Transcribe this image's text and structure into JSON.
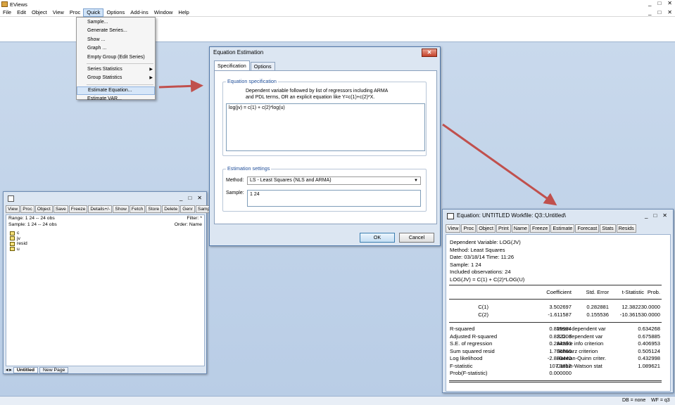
{
  "app": {
    "title": "EViews",
    "window_controls": [
      "_",
      "□",
      "✕"
    ],
    "doc_controls": [
      "_",
      "□",
      "✕"
    ]
  },
  "menubar": {
    "items": [
      "File",
      "Edit",
      "Object",
      "View",
      "Proc",
      "Quick",
      "Options",
      "Add-ins",
      "Window",
      "Help"
    ],
    "active": "Quick"
  },
  "quick_menu": {
    "items": [
      {
        "label": "Sample..."
      },
      {
        "label": "Generate Series..."
      },
      {
        "label": "Show ..."
      },
      {
        "label": "Graph ..."
      },
      {
        "label": "Empty Group (Edit Series)"
      },
      {
        "label": "Series Statistics",
        "submenu": "▶"
      },
      {
        "label": "Group Statistics",
        "submenu": "▶"
      },
      {
        "label": "Estimate Equation..."
      },
      {
        "label": "Estimate VAR..."
      }
    ]
  },
  "workfile": {
    "controls": [
      "_",
      "□",
      "✕"
    ],
    "toolbar": [
      "View",
      "Proc",
      "Object",
      "Save",
      "Freeze",
      "Details+/-",
      "Show",
      "Fetch",
      "Store",
      "Delete",
      "Genr",
      "Sample"
    ],
    "range_label": "Range:  1 24  --  24 obs",
    "sample_label": "Sample: 1 24  --  24 obs",
    "filter_label": "Filter: *",
    "order_label": "Order: Name",
    "objects": [
      "c",
      "jv",
      "resid",
      "u"
    ],
    "tabs": [
      "◂ ▸",
      "Untitled",
      "New Page"
    ]
  },
  "dialog": {
    "title": "Equation Estimation",
    "close_label": "✕",
    "tabs": [
      "Specification",
      "Options"
    ],
    "spec_group_title": "Equation specification",
    "help_line1": "Dependent variable followed by list of regressors including ARMA",
    "help_line2": "and PDL terms, OR an explicit equation like Y=c(1)+c(2)*X.",
    "equation_text": "log(jv) = c(1) + c(2)*log(u)",
    "settings_group_title": "Estimation settings",
    "method_label": "Method:",
    "method_value": "LS  - Least Squares (NLS and ARMA)",
    "method_arrow": "▼",
    "sample_label": "Sample:",
    "sample_value": "1 24",
    "ok_label": "OK",
    "cancel_label": "Cancel"
  },
  "equation_window": {
    "title": "Equation: UNTITLED   Workfile: Q3::Untitled\\",
    "controls": [
      "_",
      "□",
      "✕"
    ],
    "toolbar": [
      "View",
      "Proc",
      "Object",
      "Print",
      "Name",
      "Freeze",
      "Estimate",
      "Forecast",
      "Stats",
      "Resids"
    ],
    "header_lines": [
      "Dependent Variable: LOG(JV)",
      "Method: Least Squares",
      "Date: 03/18/14   Time: 11:26",
      "Sample: 1 24",
      "Included observations: 24",
      "LOG(JV) = C(1) + C(2)*LOG(U)"
    ],
    "coef_headers": [
      "Coefficient",
      "Std. Error",
      "t-Statistic",
      "Prob."
    ],
    "coef_rows": [
      {
        "name": "C(1)",
        "coef": "3.502697",
        "se": "0.282881",
        "t": "12.38223",
        "p": "0.0000"
      },
      {
        "name": "C(2)",
        "coef": "-1.611587",
        "se": "0.155536",
        "t": "-10.36153",
        "p": "0.0000"
      }
    ],
    "stats_rows": [
      {
        "l": "R-squared",
        "lv": "0.829934",
        "r": "Mean dependent var",
        "rv": "0.634268"
      },
      {
        "l": "Adjusted R-squared",
        "lv": "0.822203",
        "r": "S.D. dependent var",
        "rv": "0.675885"
      },
      {
        "l": "S.E. of regression",
        "lv": "0.284993",
        "r": "Akaike info criterion",
        "rv": "0.406953"
      },
      {
        "l": "Sum squared resid",
        "lv": "1.786866",
        "r": "Schwarz criterion",
        "rv": "0.505124"
      },
      {
        "l": "Log likelihood",
        "lv": "-2.883440",
        "r": "Hannan-Quinn criter.",
        "rv": "0.432998"
      },
      {
        "l": "F-statistic",
        "lv": "107.3612",
        "r": "Durbin-Watson stat",
        "rv": "1.089621"
      },
      {
        "l": "Prob(F-statistic)",
        "lv": "0.000000",
        "r": "",
        "rv": ""
      }
    ]
  },
  "statusbar": {
    "db": "DB = none",
    "wf": "WF = q3"
  },
  "colors": {
    "arrow": "#c0504d",
    "desktop": "#c9d9ec",
    "group_title": "#1f4e99"
  }
}
